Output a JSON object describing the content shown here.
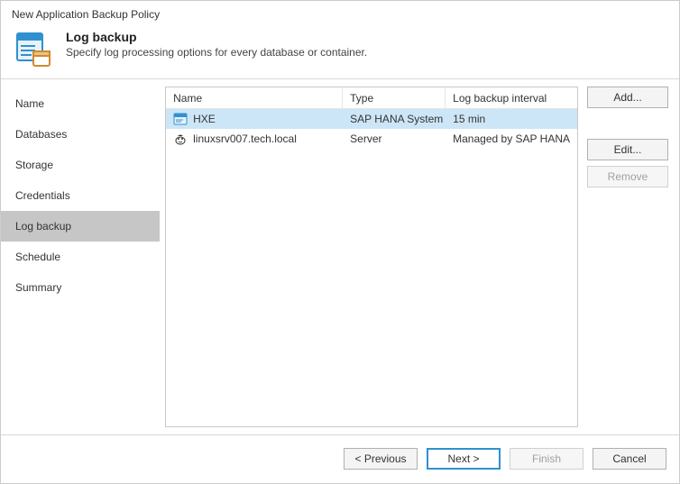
{
  "window": {
    "title": "New Application Backup Policy"
  },
  "header": {
    "title": "Log backup",
    "subtitle": "Specify log processing options for every database or container."
  },
  "sidebar": {
    "items": [
      {
        "label": "Name"
      },
      {
        "label": "Databases"
      },
      {
        "label": "Storage"
      },
      {
        "label": "Credentials"
      },
      {
        "label": "Log backup"
      },
      {
        "label": "Schedule"
      },
      {
        "label": "Summary"
      }
    ]
  },
  "table": {
    "columns": {
      "name": "Name",
      "type": "Type",
      "interval": "Log backup interval"
    },
    "rows": [
      {
        "name": "HXE",
        "type": "SAP HANA System",
        "interval": "15 min"
      },
      {
        "name": "linuxsrv007.tech.local",
        "type": "Server",
        "interval": "Managed by SAP HANA"
      }
    ]
  },
  "actions": {
    "add": "Add...",
    "edit": "Edit...",
    "remove": "Remove"
  },
  "footer": {
    "previous": "< Previous",
    "next": "Next >",
    "finish": "Finish",
    "cancel": "Cancel"
  }
}
